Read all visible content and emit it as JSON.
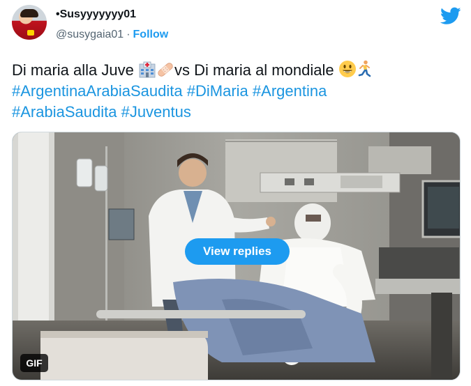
{
  "author": {
    "name": "•Susyyyyyyy01",
    "handle": "@susygaia01",
    "separator": "·",
    "follow_label": "Follow"
  },
  "tweet": {
    "text_part1": "Di maria alla Juve ",
    "text_part2": "vs Di maria al mondiale ",
    "hashtags_line1": [
      "#ArgentinaArabiaSaudita",
      "#DiMaria",
      "#Argentina"
    ],
    "hashtags_line2": [
      "#ArabiaSaudita",
      "#Juventus"
    ],
    "emojis": [
      "hospital-icon",
      "bandage-icon",
      "smiley-icon",
      "runner-icon"
    ]
  },
  "media": {
    "view_replies_label": "View replies",
    "gif_label": "GIF"
  },
  "colors": {
    "link_blue": "#1b95e0",
    "button_blue": "#1d9bf0",
    "muted_gray": "#536471",
    "text": "#0f1419"
  }
}
